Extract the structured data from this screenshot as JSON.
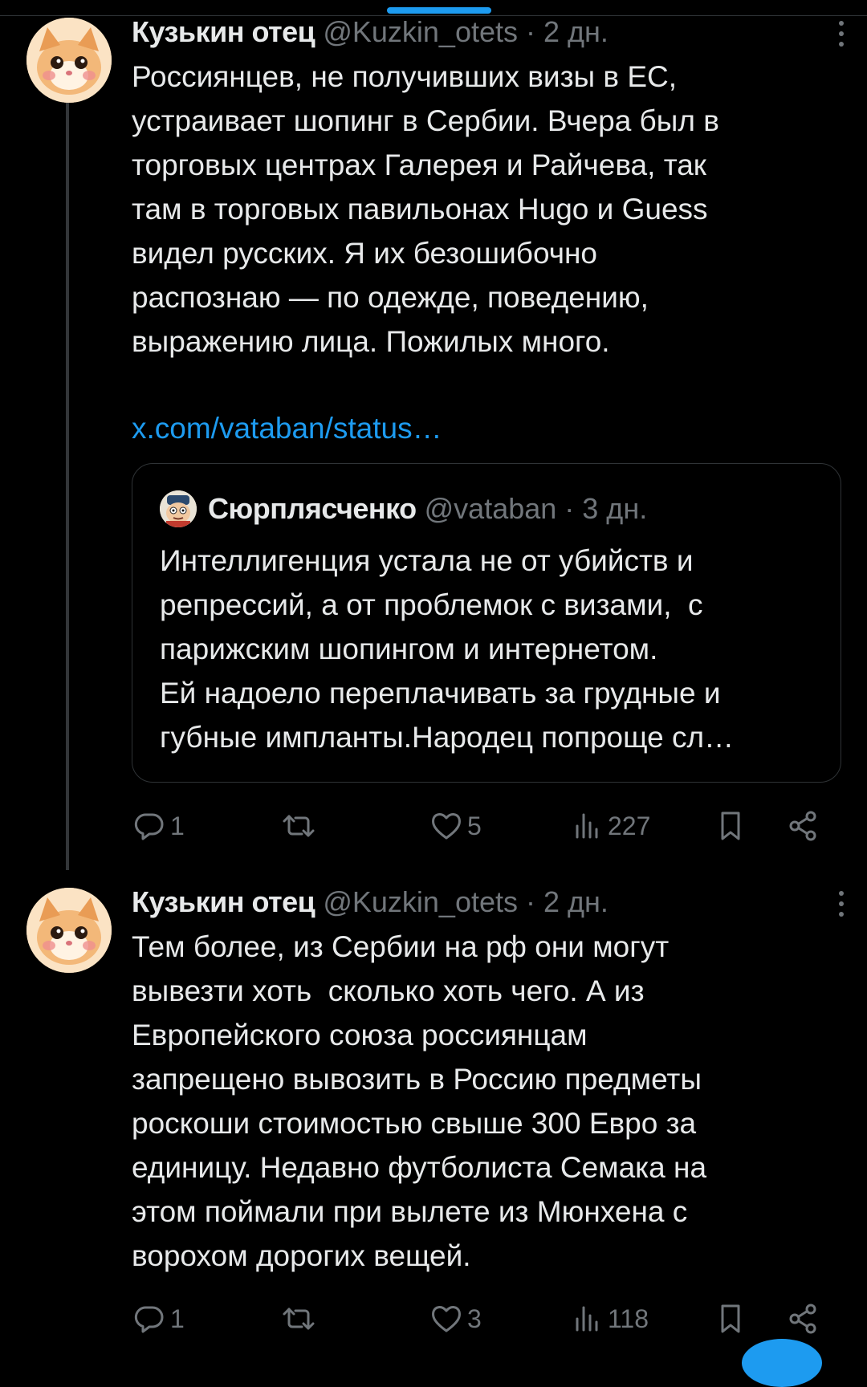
{
  "tweets": [
    {
      "author_name": "Кузькин отец",
      "handle": "@Kuzkin_otets",
      "time": "· 2 дн.",
      "text": "Россиянцев, не получивших визы в ЕС,\nустраивает шопинг в Сербии. Вчера был в\nторговых центрах Галерея и Райчева, так\nтам в торговых павильонах Hugo и Guess\nвидел русских. Я их безошибочно\nраспознаю — по одежде, поведению,\nвыражению лица. Пожилых много.",
      "link": "x.com/vataban/status…",
      "quote": {
        "author_name": "Сюрплясченко",
        "handle": "@vataban",
        "time": "· 3 дн.",
        "text": "Интеллигенция устала не от убийств и\nрепрессий, а от проблемок с визами,  с\nпарижским шопингом и интернетом.\nЕй надоело переплачивать за грудные и\nгубные импланты.Народец попроще сл…"
      },
      "stats": {
        "replies": "1",
        "reposts": "",
        "likes": "5",
        "views": "227"
      }
    },
    {
      "author_name": "Кузькин отец",
      "handle": "@Kuzkin_otets",
      "time": "· 2 дн.",
      "text": "Тем более, из Сербии на рф они могут\nвывезти хоть  сколько хоть чего. А из\nЕвропейского союза россиянцам\nзапрещено вывозить в Россию предметы\nроскоши стоимостью свыше 300 Евро за\nединицу. Недавно футболиста Семака на\nэтом поймали при вылете из Мюнхена с\nворохом дорогих вещей.",
      "stats": {
        "replies": "1",
        "reposts": "",
        "likes": "3",
        "views": "118"
      }
    }
  ],
  "icons": {
    "reply": "reply-icon",
    "repost": "repost-icon",
    "like": "heart-icon",
    "views": "views-icon",
    "bookmark": "bookmark-icon",
    "share": "share-icon",
    "more": "more-icon"
  },
  "colors": {
    "background": "#000000",
    "text": "#e7e9ea",
    "muted": "#71767b",
    "accent": "#1d9bf0",
    "border": "#2f3336"
  }
}
